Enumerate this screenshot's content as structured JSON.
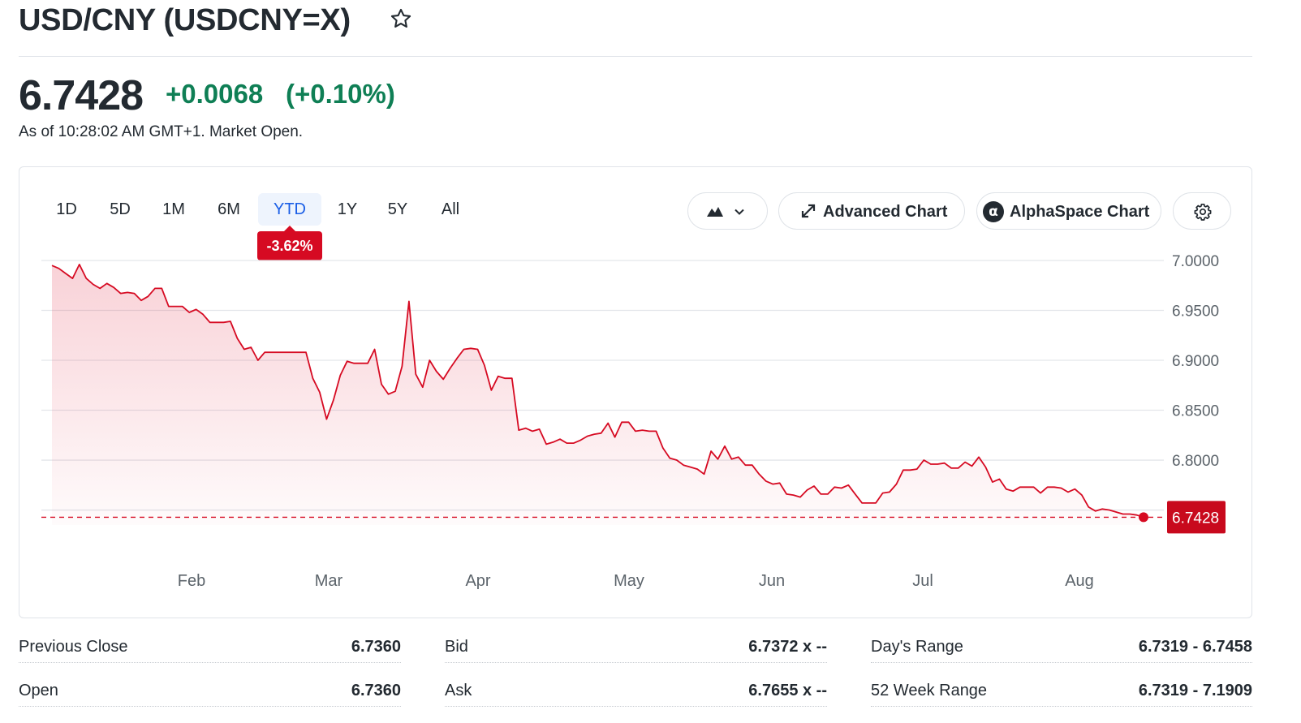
{
  "header": {
    "title": "USD/CNY (USDCNY=X)"
  },
  "quote": {
    "price": "6.7428",
    "change": "+0.0068",
    "change_pct": "(+0.10%)",
    "as_of": "As of 10:28:02 AM GMT+1. Market Open."
  },
  "range_tabs": [
    {
      "label": "1D"
    },
    {
      "label": "5D"
    },
    {
      "label": "1M"
    },
    {
      "label": "6M"
    },
    {
      "label": "YTD",
      "active": true
    },
    {
      "label": "1Y"
    },
    {
      "label": "5Y"
    },
    {
      "label": "All"
    }
  ],
  "ytd_badge": "-3.62%",
  "toolbar": {
    "advanced_chart": "Advanced Chart",
    "alphaspace_chart": "AlphaSpace Chart",
    "alpha_symbol": "α"
  },
  "colors": {
    "up": "#0f7f55",
    "down": "#d60a22",
    "active_tab": "#1a5ee6"
  },
  "chart_data": {
    "type": "area",
    "x_tick_labels": [
      "Feb",
      "Mar",
      "Apr",
      "May",
      "Jun",
      "Jul",
      "Aug"
    ],
    "y_tick_labels": [
      "7.0000",
      "6.9500",
      "6.9000",
      "6.8500",
      "6.8000"
    ],
    "ylim": [
      6.735,
      7.0
    ],
    "y_ticks": [
      7.0,
      6.95,
      6.9,
      6.85,
      6.8
    ],
    "last_value": 6.7428,
    "last_value_label": "6.7428",
    "grid": true,
    "values": [
      6.995,
      6.992,
      6.987,
      6.982,
      6.996,
      6.982,
      6.976,
      6.972,
      6.977,
      6.973,
      6.967,
      6.968,
      6.967,
      6.96,
      6.964,
      6.972,
      6.972,
      6.954,
      6.954,
      6.954,
      6.948,
      6.951,
      6.946,
      6.938,
      6.938,
      6.938,
      6.939,
      6.922,
      6.911,
      6.913,
      6.9,
      6.908,
      6.908,
      6.908,
      6.908,
      6.908,
      6.908,
      6.908,
      6.882,
      6.868,
      6.841,
      6.86,
      6.885,
      6.899,
      6.897,
      6.897,
      6.897,
      6.911,
      6.876,
      6.866,
      6.869,
      6.894,
      6.959,
      6.886,
      6.873,
      6.9,
      6.889,
      6.881,
      6.892,
      6.902,
      6.911,
      6.912,
      6.911,
      6.895,
      6.87,
      6.884,
      6.882,
      6.882,
      6.83,
      6.832,
      6.829,
      6.831,
      6.816,
      6.818,
      6.821,
      6.817,
      6.817,
      6.82,
      6.824,
      6.826,
      6.827,
      6.837,
      6.823,
      6.838,
      6.838,
      6.829,
      6.83,
      6.829,
      6.829,
      6.812,
      6.802,
      6.8,
      6.795,
      6.793,
      6.791,
      6.786,
      6.809,
      6.801,
      6.814,
      6.801,
      6.803,
      6.795,
      6.795,
      6.786,
      6.779,
      6.776,
      6.777,
      6.766,
      6.765,
      6.763,
      6.77,
      6.774,
      6.766,
      6.766,
      6.773,
      6.772,
      6.775,
      6.766,
      6.757,
      6.757,
      6.757,
      6.767,
      6.768,
      6.776,
      6.79,
      6.79,
      6.791,
      6.8,
      6.796,
      6.796,
      6.797,
      6.792,
      6.792,
      6.798,
      6.794,
      6.803,
      6.793,
      6.778,
      6.781,
      6.771,
      6.769,
      6.773,
      6.773,
      6.773,
      6.767,
      6.773,
      6.773,
      6.772,
      6.768,
      6.771,
      6.765,
      6.753,
      6.749,
      6.751,
      6.75,
      6.748,
      6.746,
      6.746,
      6.745,
      6.7428
    ]
  },
  "stats": [
    {
      "label": "Previous Close",
      "value": "6.7360"
    },
    {
      "label": "Open",
      "value": "6.7360"
    },
    {
      "label": "Bid",
      "value": "6.7372 x --"
    },
    {
      "label": "Ask",
      "value": "6.7655 x --"
    },
    {
      "label": "Day's Range",
      "value": "6.7319 - 6.7458"
    },
    {
      "label": "52 Week Range",
      "value": "6.7319 - 7.1909"
    }
  ]
}
